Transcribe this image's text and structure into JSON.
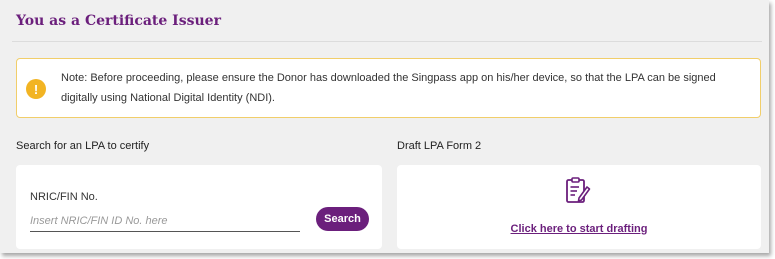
{
  "page": {
    "title": "You as a Certificate Issuer"
  },
  "note": {
    "icon": "exclamation-icon",
    "text": "Note: Before proceeding, please ensure the Donor has downloaded the Singpass app on his/her device, so that the LPA can be signed digitally using National Digital Identity (NDI)."
  },
  "search": {
    "section_label": "Search for an LPA to certify",
    "field_label": "NRIC/FIN No.",
    "input_value": "",
    "placeholder": "Insert NRIC/FIN ID No. here",
    "button_label": "Search"
  },
  "draft": {
    "section_label": "Draft LPA Form 2",
    "icon": "document-edit-icon",
    "link_label": "Click here to start drafting"
  },
  "colors": {
    "brand_purple": "#6b1f7c",
    "note_border": "#f1ce6a",
    "warning_icon": "#f2b423",
    "panel_bg": "#f0f0f0"
  }
}
